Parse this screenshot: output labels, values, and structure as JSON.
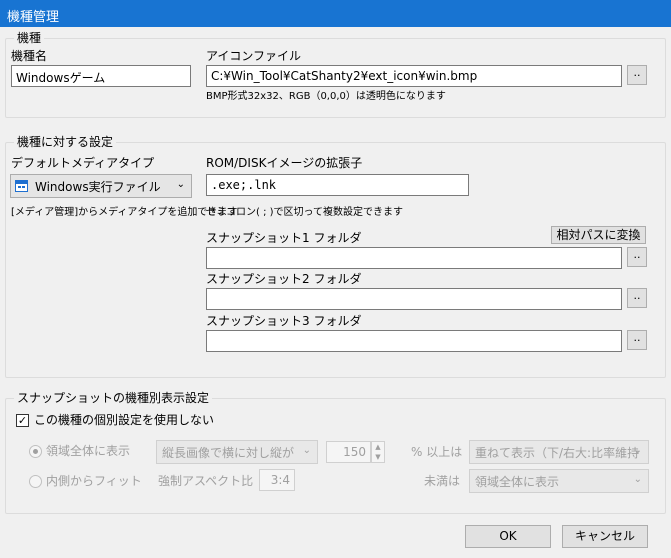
{
  "window": {
    "title": "機種管理"
  },
  "group_machine": {
    "title": "機種",
    "name_label": "機種名",
    "name_value": "Windowsゲーム",
    "icon_label": "アイコンファイル",
    "icon_value": "C:¥Win_Tool¥CatShanty2¥ext_icon¥win.bmp",
    "browse_label": "..",
    "icon_hint": "BMP形式32x32、RGB（0,0,0）は透明色になります"
  },
  "group_settings": {
    "title": "機種に対する設定",
    "media_type_label": "デフォルトメディアタイプ",
    "media_type_value": "Windows実行ファイル",
    "media_icon": "windows-window-icon",
    "media_hint": "[メディア管理]からメディアタイプを追加できます",
    "ext_label": "ROM/DISKイメージの拡張子",
    "ext_value": ".exe;.lnk",
    "ext_hint": "セミコロン( ; )で区切って複数設定できます",
    "relative_button": "相対パスに変換",
    "snap1_label": "スナップショット1 フォルダ",
    "snap1_value": "",
    "snap2_label": "スナップショット2 フォルダ",
    "snap2_value": "",
    "snap3_label": "スナップショット3 フォルダ",
    "snap3_value": "",
    "browse_label": ".."
  },
  "group_snapshot": {
    "title": "スナップショットの機種別表示設定",
    "checkbox_label": "この機種の個別設定を使用しない",
    "checkbox_checked": true,
    "radio_fill_label": "領域全体に表示",
    "radio_fit_label": "内側からフィット",
    "layout_select": "縦長画像で横に対し縦が",
    "percent_value": "150",
    "percent_label": "% 以上は",
    "over_select": "重ねて表示（下/右大:比率維持",
    "aspect_label": "強制アスペクト比",
    "aspect_value": "3:4",
    "under_label": "未満は",
    "under_select": "領域全体に表示"
  },
  "footer": {
    "ok": "OK",
    "cancel": "キャンセル"
  },
  "colors": {
    "titlebar": "#1874d2",
    "background": "#f0f0f0"
  }
}
